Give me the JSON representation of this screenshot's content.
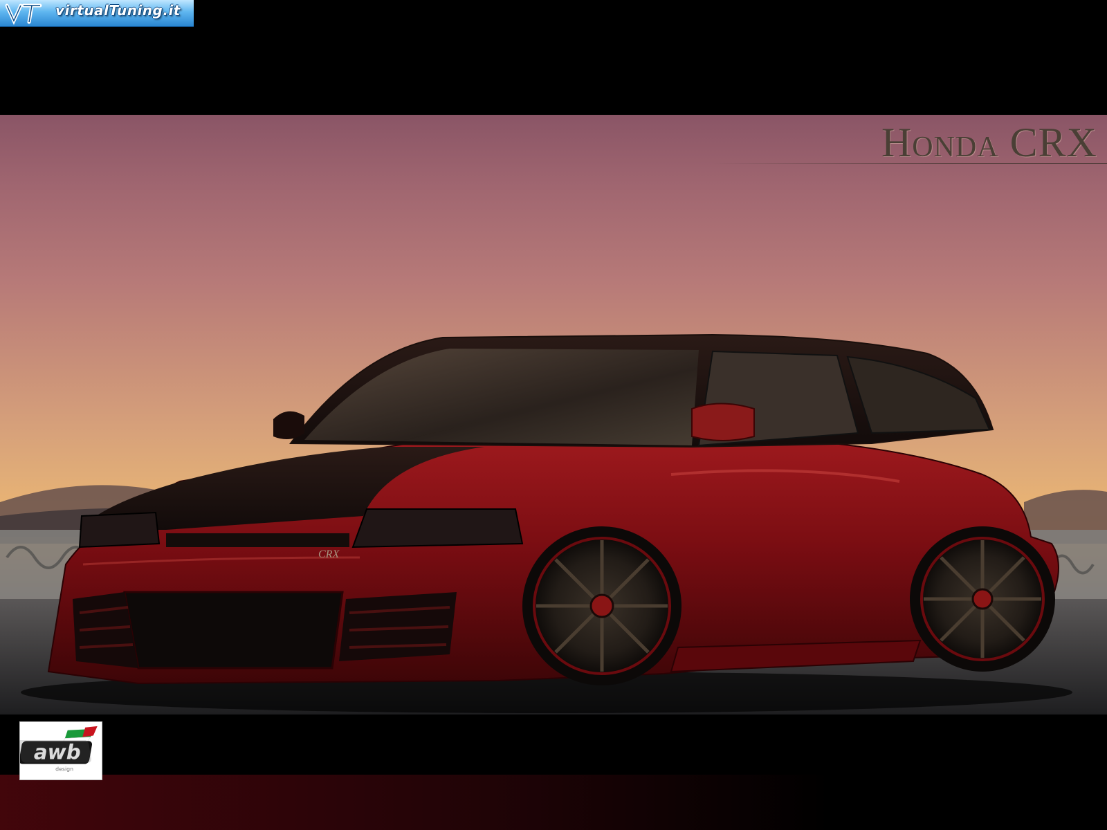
{
  "banner": {
    "site_text": "virtualTuning.it",
    "mark_text": "VT"
  },
  "photo": {
    "title": "Honda CRX",
    "badge_text": "CRX"
  },
  "logo": {
    "text": "awb",
    "subtext": "design"
  },
  "colors": {
    "car_body": "#7a0d12",
    "sky_top": "#8a5566",
    "sky_horizon": "#f0b66c",
    "banner_blue": "#2a86d1"
  },
  "icons": {
    "banner_mark": "vt-logo-icon",
    "bottom_logo": "awb-logo-icon"
  }
}
